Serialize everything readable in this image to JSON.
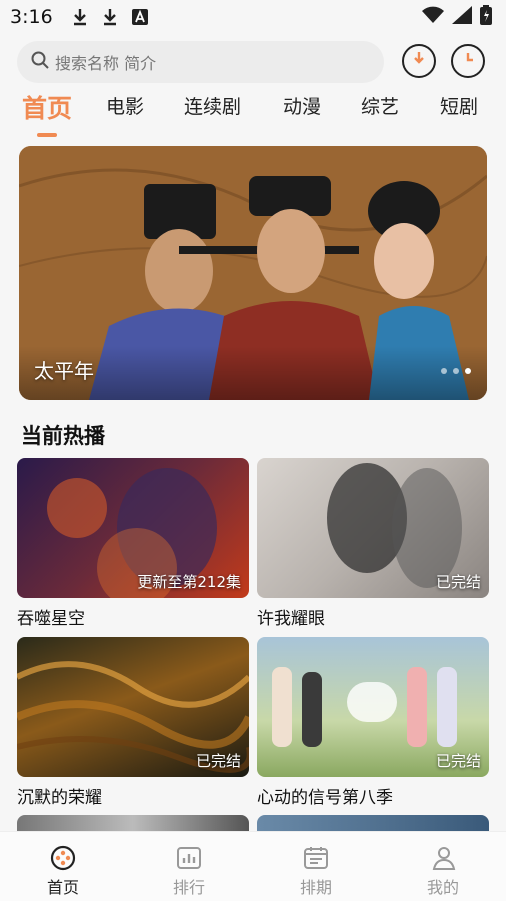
{
  "status_bar": {
    "time": "3:16",
    "icons": [
      "download-icon",
      "download-icon",
      "a-notification-icon"
    ],
    "right_icons": [
      "wifi-icon",
      "signal-icon",
      "battery-icon"
    ]
  },
  "search": {
    "placeholder": "搜索名称 简介"
  },
  "tabs": [
    {
      "label": "首页",
      "active": true
    },
    {
      "label": "电影"
    },
    {
      "label": "连续剧"
    },
    {
      "label": "动漫"
    },
    {
      "label": "综艺"
    },
    {
      "label": "短剧"
    }
  ],
  "banner": {
    "title": "太平年",
    "dot_count": 3,
    "active_dot": 2
  },
  "section": {
    "title": "当前热播"
  },
  "cards": [
    {
      "name": "吞噬星空",
      "tag": "更新至第212集"
    },
    {
      "name": "许我耀眼",
      "tag": "已完结"
    },
    {
      "name": "沉默的荣耀",
      "tag": "已完结"
    },
    {
      "name": "心动的信号第八季",
      "tag": "已完结"
    }
  ],
  "bottom_nav": [
    {
      "label": "首页",
      "icon": "film-reel-icon",
      "active": true
    },
    {
      "label": "排行",
      "icon": "bar-chart-icon"
    },
    {
      "label": "排期",
      "icon": "calendar-icon"
    },
    {
      "label": "我的",
      "icon": "user-icon"
    }
  ],
  "colors": {
    "accent": "#f08a52"
  }
}
